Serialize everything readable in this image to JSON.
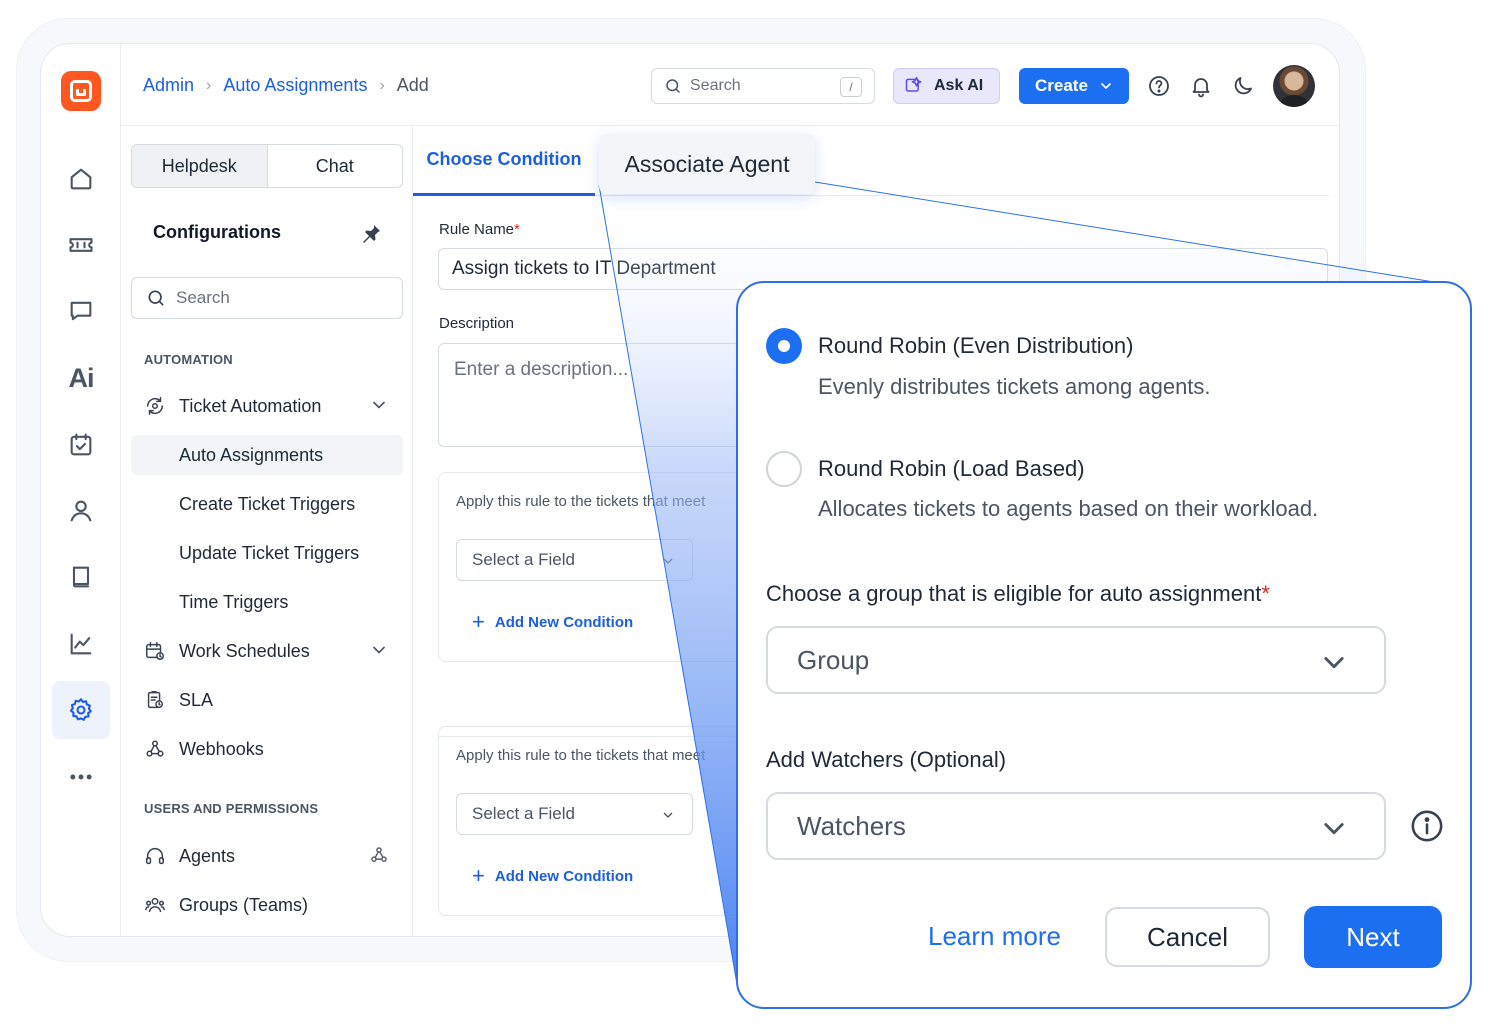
{
  "breadcrumb": {
    "items": [
      "Admin",
      "Auto Assignments"
    ],
    "current": "Add"
  },
  "topbar": {
    "search_placeholder": "Search",
    "search_shortcut": "/",
    "ask_ai_label": "Ask AI",
    "create_label": "Create"
  },
  "config": {
    "segments": [
      "Helpdesk",
      "Chat"
    ],
    "title": "Configurations",
    "search_placeholder": "Search",
    "sections": {
      "automation": "AUTOMATION",
      "users": "USERS AND PERMISSIONS"
    },
    "items": {
      "ticket_automation": "Ticket Automation",
      "auto_assignments": "Auto Assignments",
      "create_triggers": "Create Ticket Triggers",
      "update_triggers": "Update Ticket Triggers",
      "time_triggers": "Time Triggers",
      "work_schedules": "Work Schedules",
      "sla": "SLA",
      "webhooks": "Webhooks",
      "agents": "Agents",
      "groups": "Groups (Teams)"
    }
  },
  "main": {
    "tabs": {
      "choose_condition": "Choose Condition",
      "associate_agent": "Associate Agent"
    },
    "rule_name_label": "Rule Name",
    "rule_name_value": "Assign tickets to IT Department",
    "description_label": "Description",
    "description_placeholder": "Enter a description...",
    "rule_sentence": "Apply this rule to the tickets that meet",
    "select_field": "Select a Field",
    "add_condition": "Add New Condition"
  },
  "assign_panel": {
    "option1_title": "Round Robin (Even Distribution)",
    "option1_desc": "Evenly distributes tickets among agents.",
    "option2_title": "Round Robin (Load Based)",
    "option2_desc": "Allocates tickets to agents based on their workload.",
    "group_label": "Choose a group that is eligible for auto assignment",
    "group_placeholder": "Group",
    "watchers_label": "Add Watchers (Optional)",
    "watchers_placeholder": "Watchers",
    "learn_more": "Learn more",
    "cancel": "Cancel",
    "next": "Next"
  },
  "colors": {
    "accent": "#1d6ff2",
    "brand": "#ff5722",
    "required": "#dc2626"
  },
  "icons": [
    "home-icon",
    "ticket-icon",
    "chat-icon",
    "ai-icon",
    "calendar-check-icon",
    "user-icon",
    "book-icon",
    "chart-icon",
    "settings-icon",
    "more-icon"
  ]
}
